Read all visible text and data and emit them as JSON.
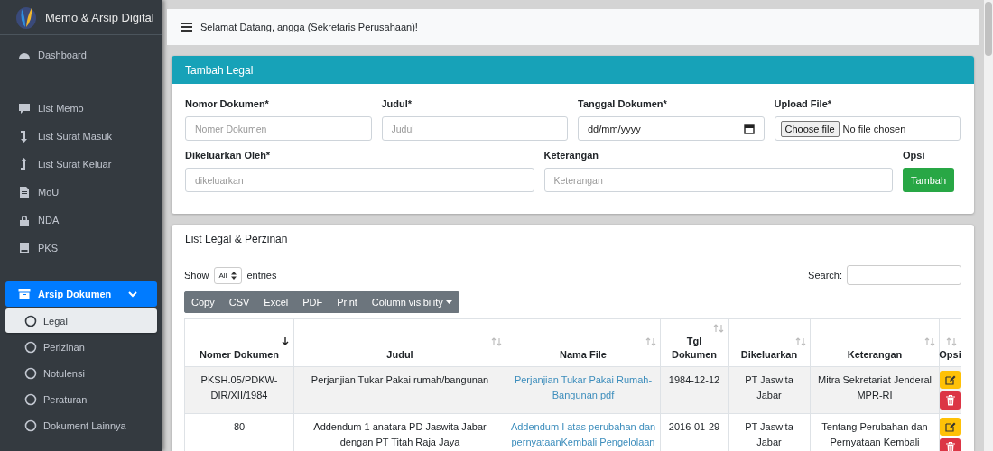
{
  "brand": {
    "title": "Memo & Arsip Digital"
  },
  "sidebar": {
    "groups": [
      [
        {
          "label": "Dashboard"
        }
      ],
      [
        {
          "label": "List Memo"
        },
        {
          "label": "List Surat Masuk"
        },
        {
          "label": "List Surat Keluar"
        },
        {
          "label": "MoU"
        },
        {
          "label": "NDA"
        },
        {
          "label": "PKS"
        }
      ]
    ],
    "archive": {
      "label": "Arsip Dokumen",
      "selected": true,
      "expanded": true,
      "children": [
        {
          "label": "Legal",
          "selected": true
        },
        {
          "label": "Perizinan",
          "selected": false
        },
        {
          "label": "Notulensi",
          "selected": false
        },
        {
          "label": "Peraturan",
          "selected": false
        },
        {
          "label": "Dokument Lainnya",
          "selected": false
        }
      ]
    }
  },
  "navbar": {
    "greeting": "Selamat Datang, angga (Sekretaris Perusahaan)!"
  },
  "form_card": {
    "title": "Tambah Legal",
    "fields": [
      {
        "kind": "text",
        "label": "Nomor Dokumen*",
        "placeholder": "Nomer Dokumen"
      },
      {
        "kind": "text",
        "label": "Judul*",
        "placeholder": "Judul"
      },
      {
        "kind": "date",
        "label": "Tanggal Dokumen*",
        "placeholder": "dd/mm/yyyy"
      },
      {
        "kind": "file",
        "label": "Upload File*",
        "button": "Choose file",
        "status": "No file chosen"
      },
      {
        "kind": "text",
        "label": "Dikeluarkan Oleh*",
        "placeholder": "dikeluarkan"
      },
      {
        "kind": "text",
        "label": "Keterangan",
        "placeholder": "Keterangan"
      },
      {
        "kind": "button",
        "label": "Opsi",
        "button": "Tambah"
      }
    ]
  },
  "list_card": {
    "title": "List Legal & Perzinan",
    "show_label": "Show",
    "length_value": "All",
    "entries_label": "entries",
    "search_label": "Search:",
    "export_buttons": [
      {
        "label": "Copy",
        "dropdown": false
      },
      {
        "label": "CSV",
        "dropdown": false
      },
      {
        "label": "Excel",
        "dropdown": false
      },
      {
        "label": "PDF",
        "dropdown": false
      },
      {
        "label": "Print",
        "dropdown": false
      },
      {
        "label": "Column visibility",
        "dropdown": true
      }
    ],
    "table": {
      "columns": [
        {
          "label": "Nomer Dokumen",
          "sorted": true
        },
        {
          "label": "Judul",
          "sorted": false
        },
        {
          "label": "Nama File",
          "sorted": false
        },
        {
          "label": "Tgl Dokumen",
          "sorted": false
        },
        {
          "label": "Dikeluarkan",
          "sorted": false
        },
        {
          "label": "Keterangan",
          "sorted": false
        },
        {
          "label": "Opsi",
          "sorted": false
        }
      ],
      "rows": [
        {
          "nomor": "PKSH.05/PDKW-DIR/XII/1984",
          "judul": "Perjanjian Tukar Pakai rumah/bangunan",
          "file": "Perjanjian Tukar Pakai Rumah-Bangunan.pdf",
          "tanggal": "1984-12-12",
          "dikeluarkan": "PT Jaswita Jabar",
          "keterangan": "Mitra Sekretariat Jenderal MPR-RI"
        },
        {
          "nomor": "80",
          "judul": "Addendum 1 anatara PD Jaswita Jabar dengan PT Titah Raja Jaya",
          "file": "Addendum I atas perubahan dan pernyataanKembali Pengelolaan",
          "tanggal": "2016-01-29",
          "dikeluarkan": "PT Jaswita Jabar",
          "keterangan": "Tentang Perubahan dan Pernyataan Kembali"
        }
      ]
    }
  }
}
